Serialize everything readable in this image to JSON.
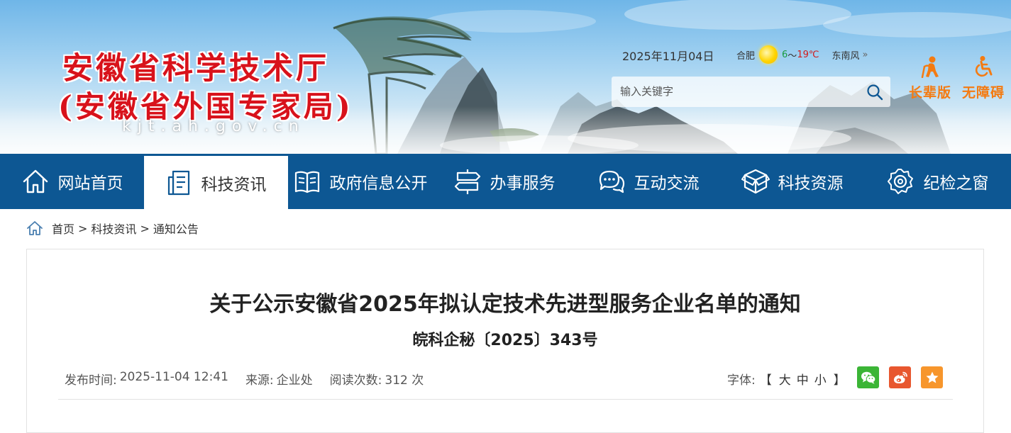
{
  "header": {
    "logo_line1": "安徽省科学技术厅",
    "logo_line2": "(安徽省外国专家局)",
    "logo_url": "kjt.ah.gov.cn",
    "date": "2025年11月04日",
    "weather": {
      "city": "合肥",
      "icon": "sun-icon",
      "temp_low": "6",
      "temp_sep": "～",
      "temp_high": "19℃",
      "wind": "东南风",
      "more_icon": "double-chevron-right-icon"
    },
    "search": {
      "placeholder": "输入关键字",
      "icon": "search-icon"
    },
    "accessibility": [
      {
        "label": "长辈版",
        "icon": "elder-icon"
      },
      {
        "label": "无障碍",
        "icon": "wheelchair-icon"
      }
    ]
  },
  "nav": {
    "items": [
      {
        "label": "网站首页",
        "icon": "home-icon"
      },
      {
        "label": "科技资讯",
        "icon": "document-icon",
        "active": true
      },
      {
        "label": "政府信息公开",
        "icon": "book-icon"
      },
      {
        "label": "办事服务",
        "icon": "signpost-icon"
      },
      {
        "label": "互动交流",
        "icon": "chat-icon"
      },
      {
        "label": "科技资源",
        "icon": "box-icon"
      },
      {
        "label": "纪检之窗",
        "icon": "badge-icon"
      }
    ]
  },
  "breadcrumb": {
    "icon": "home-icon",
    "items": [
      "首页",
      "科技资讯",
      "通知公告"
    ],
    "separator": ">"
  },
  "article": {
    "title": "关于公示安徽省2025年拟认定技术先进型服务企业名单的通知",
    "doc_number": "皖科企秘〔2025〕343号",
    "meta": {
      "publish_label": "发布时间:",
      "publish_time": "2025-11-04 12:41",
      "source_label": "来源:",
      "source": "企业处",
      "reads_label": "阅读次数:",
      "reads": "312 次"
    },
    "font_size": {
      "label": "字体:",
      "open_bracket": "【",
      "options": [
        "大",
        "中",
        "小"
      ],
      "close_bracket": "】"
    },
    "share": [
      "wechat-icon",
      "weibo-icon",
      "star-icon"
    ]
  },
  "colors": {
    "nav_bg": "#0d5793",
    "logo_red": "#d8121b",
    "accent_orange": "#f47b12",
    "wechat": "#3bb536",
    "weibo": "#e8572f",
    "favorite": "#f7962c"
  }
}
